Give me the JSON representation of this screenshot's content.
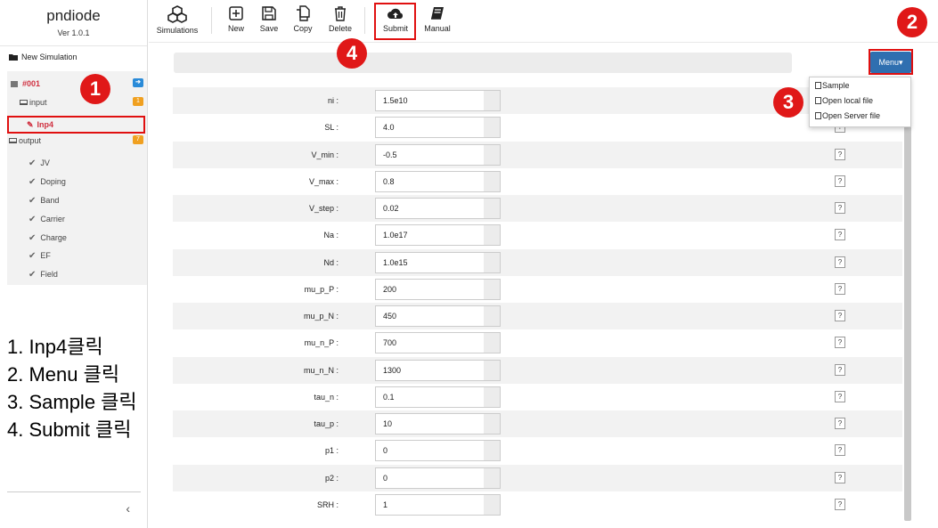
{
  "brand": {
    "name": "pndiode",
    "version": "Ver 1.0.1"
  },
  "sidebar": {
    "new_simulation": "New Simulation",
    "sim_label": "#001",
    "input_label": "input",
    "input_badge": "1",
    "inp4_label": "Inp4",
    "output_label": "output",
    "output_badge": "7",
    "outputs": [
      "JV",
      "Doping",
      "Band",
      "Carrier",
      "Charge",
      "EF",
      "Field"
    ],
    "collapse_glyph": "‹"
  },
  "toolbar": {
    "simulations": "Simulations",
    "new": "New",
    "save": "Save",
    "copy": "Copy",
    "delete": "Delete",
    "submit": "Submit",
    "manual": "Manual"
  },
  "menu": {
    "button": "Menu▾",
    "items": [
      "Sample",
      "Open local file",
      "Open Server file"
    ]
  },
  "params": [
    {
      "label": "ni :",
      "value": "1.5e10"
    },
    {
      "label": "SL :",
      "value": "4.0"
    },
    {
      "label": "V_min :",
      "value": "-0.5"
    },
    {
      "label": "V_max :",
      "value": "0.8"
    },
    {
      "label": "V_step :",
      "value": "0.02"
    },
    {
      "label": "Na :",
      "value": "1.0e17"
    },
    {
      "label": "Nd :",
      "value": "1.0e15"
    },
    {
      "label": "mu_p_P :",
      "value": "200"
    },
    {
      "label": "mu_p_N :",
      "value": "450"
    },
    {
      "label": "mu_n_P :",
      "value": "700"
    },
    {
      "label": "mu_n_N :",
      "value": "1300"
    },
    {
      "label": "tau_n :",
      "value": "0.1"
    },
    {
      "label": "tau_p :",
      "value": "10"
    },
    {
      "label": "p1 :",
      "value": "0"
    },
    {
      "label": "p2 :",
      "value": "0"
    },
    {
      "label": "SRH :",
      "value": "1"
    }
  ],
  "help_glyph": "?",
  "instructions": [
    "1. Inp4클릭",
    "2. Menu 클릭",
    "3. Sample 클릭",
    "4. Submit 클릭"
  ],
  "markers": [
    "1",
    "2",
    "3",
    "4"
  ],
  "colors": {
    "accent": "#2f6fb0",
    "highlight": "#e01010",
    "sim_red": "#d03040"
  }
}
